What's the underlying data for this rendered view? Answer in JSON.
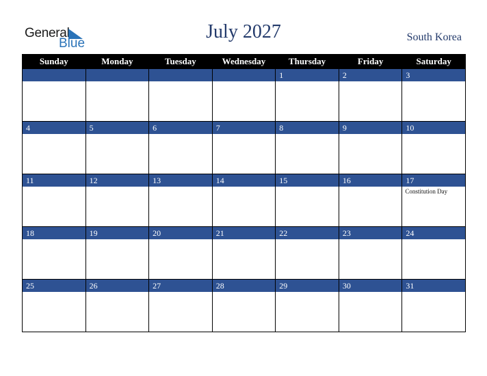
{
  "logo": {
    "general": "General",
    "blue": "Blue"
  },
  "title": "July 2027",
  "country": "South Korea",
  "colors": {
    "header_bg": "#000000",
    "band_bg": "#2e5293",
    "title": "#233a6b",
    "logo_blue": "#2a73b8"
  },
  "weekdays": [
    "Sunday",
    "Monday",
    "Tuesday",
    "Wednesday",
    "Thursday",
    "Friday",
    "Saturday"
  ],
  "weeks": [
    {
      "days": [
        "",
        "",
        "",
        "",
        "1",
        "2",
        "3"
      ],
      "events": [
        "",
        "",
        "",
        "",
        "",
        "",
        ""
      ]
    },
    {
      "days": [
        "4",
        "5",
        "6",
        "7",
        "8",
        "9",
        "10"
      ],
      "events": [
        "",
        "",
        "",
        "",
        "",
        "",
        ""
      ]
    },
    {
      "days": [
        "11",
        "12",
        "13",
        "14",
        "15",
        "16",
        "17"
      ],
      "events": [
        "",
        "",
        "",
        "",
        "",
        "",
        "Constitution Day"
      ]
    },
    {
      "days": [
        "18",
        "19",
        "20",
        "21",
        "22",
        "23",
        "24"
      ],
      "events": [
        "",
        "",
        "",
        "",
        "",
        "",
        ""
      ]
    },
    {
      "days": [
        "25",
        "26",
        "27",
        "28",
        "29",
        "30",
        "31"
      ],
      "events": [
        "",
        "",
        "",
        "",
        "",
        "",
        ""
      ]
    }
  ]
}
